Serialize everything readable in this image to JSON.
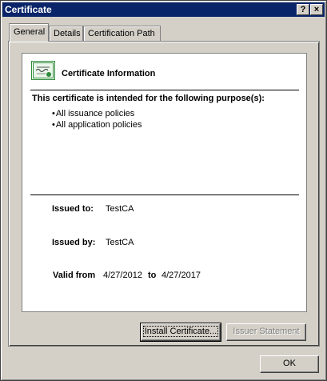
{
  "window": {
    "title": "Certificate",
    "help_glyph": "?",
    "close_glyph": "×"
  },
  "tabs": [
    {
      "label": "General"
    },
    {
      "label": "Details"
    },
    {
      "label": "Certification Path"
    }
  ],
  "general": {
    "info_title": "Certificate Information",
    "purpose_heading": "This certificate is intended for the following purpose(s):",
    "purposes": [
      "All issuance policies",
      "All application policies"
    ],
    "issued_to_label": "Issued to:",
    "issued_to_value": "TestCA",
    "issued_by_label": "Issued by:",
    "issued_by_value": "TestCA",
    "valid_from_label": "Valid from",
    "valid_from_value": "4/27/2012",
    "valid_to_label": "to",
    "valid_to_value": "4/27/2017"
  },
  "buttons": {
    "install": "Install Certificate...",
    "issuer_statement": "Issuer Statement",
    "ok": "OK"
  },
  "icons": {
    "certificate": "certificate-icon",
    "help": "help-icon",
    "close": "close-icon"
  },
  "colors": {
    "titlebar": "#0a246a",
    "dialog": "#d4d0c8",
    "cert_green": "#2e8b3a"
  }
}
